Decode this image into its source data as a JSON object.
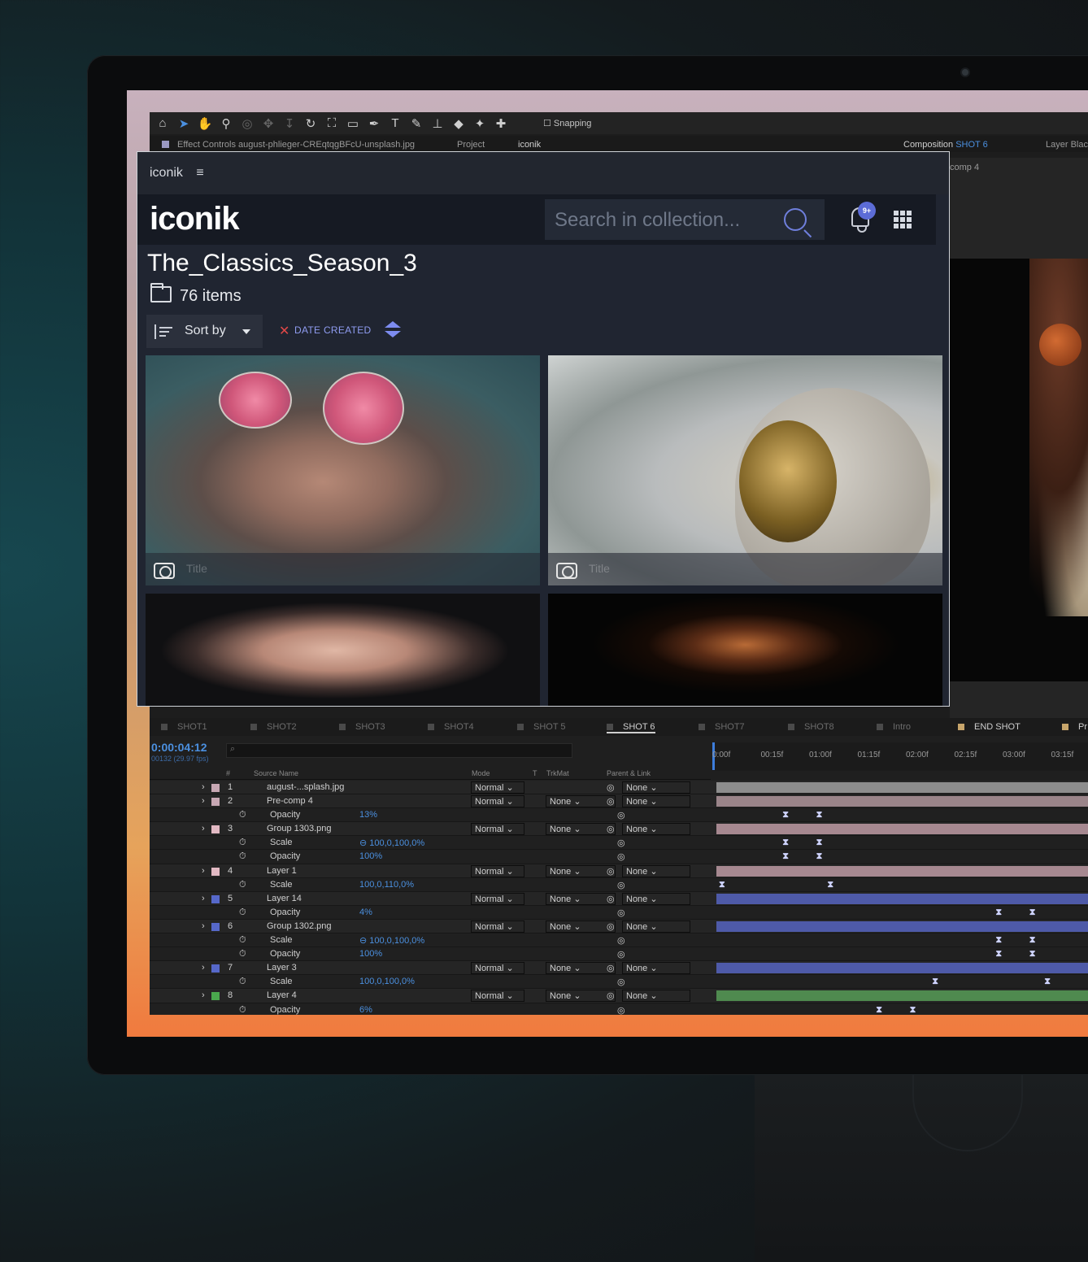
{
  "ae": {
    "snapping_label": "Snapping",
    "effect_controls_tab": "Effect Controls august-phlieger-CREqtqgBFcU-unsplash.jpg",
    "project_tab": "Project",
    "iconik_tab": "iconik",
    "composition_label": "Composition",
    "composition_name": "SHOT 6",
    "layer_tab": "Layer Black",
    "comp_breadcrumb": "comp 4",
    "timeline_tabs": [
      "SHOT1",
      "SHOT2",
      "SHOT3",
      "SHOT4",
      "SHOT 5",
      "SHOT 6",
      "SHOT7",
      "SHOT8",
      "Intro",
      "END SHOT",
      "Pr"
    ],
    "timecode": "0:00:04:12",
    "fps": "00132 (29.97 fps)",
    "search_glyph": "⌕",
    "columns": {
      "source_name": "Source Name",
      "mode": "Mode",
      "trkmat_t": "T",
      "trkmat": "TrkMat",
      "parent": "Parent & Link",
      "number": "#"
    },
    "ruler": [
      "0:00f",
      "00:15f",
      "01:00f",
      "01:15f",
      "02:00f",
      "02:15f",
      "03:00f",
      "03:15f"
    ],
    "rows": [
      {
        "kind": "layer",
        "num": "1",
        "name": "august-...splash.jpg",
        "mode": "Normal",
        "trkmat": "",
        "parent": "None",
        "label_color": "#c7a7b3",
        "bar_color": "#8d8d8d"
      },
      {
        "kind": "layer",
        "num": "2",
        "name": "Pre-comp 4",
        "mode": "Normal",
        "trkmat": "None",
        "parent": "None",
        "label_color": "#c7a7b3",
        "bar_color": "#9a8489"
      },
      {
        "kind": "prop",
        "name": "Opacity",
        "value": "13%",
        "keys": [
          0.17,
          0.26
        ]
      },
      {
        "kind": "layer",
        "num": "3",
        "name": "Group 1303.png",
        "mode": "Normal",
        "trkmat": "None",
        "parent": "None",
        "label_color": "#e2b9c3",
        "bar_color": "#a68890"
      },
      {
        "kind": "prop",
        "name": "Scale",
        "value": "100,0,100,0%",
        "link": true,
        "keys": [
          0.17,
          0.26
        ]
      },
      {
        "kind": "prop",
        "name": "Opacity",
        "value": "100%",
        "keys": [
          0.17,
          0.26
        ]
      },
      {
        "kind": "layer",
        "num": "4",
        "name": "Layer 1",
        "mode": "Normal",
        "trkmat": "None",
        "parent": "None",
        "label_color": "#e2b9c3",
        "bar_color": "#a68890"
      },
      {
        "kind": "prop",
        "name": "Scale",
        "value": "100,0,110,0%",
        "keys": [
          0.0,
          0.29
        ]
      },
      {
        "kind": "layer",
        "num": "5",
        "name": "Layer 14",
        "mode": "Normal",
        "trkmat": "None",
        "parent": "None",
        "label_color": "#5668c9",
        "bar_color": "#4e5aa8"
      },
      {
        "kind": "prop",
        "name": "Opacity",
        "value": "4%",
        "keys": [
          0.74,
          0.83
        ]
      },
      {
        "kind": "layer",
        "num": "6",
        "name": "Group 1302.png",
        "mode": "Normal",
        "trkmat": "None",
        "parent": "None",
        "label_color": "#5668c9",
        "bar_color": "#4e5aa8"
      },
      {
        "kind": "prop",
        "name": "Scale",
        "value": "100,0,100,0%",
        "link": true,
        "keys": [
          0.74,
          0.83
        ]
      },
      {
        "kind": "prop",
        "name": "Opacity",
        "value": "100%",
        "keys": [
          0.74,
          0.83
        ]
      },
      {
        "kind": "layer",
        "num": "7",
        "name": "Layer 3",
        "mode": "Normal",
        "trkmat": "None",
        "parent": "None",
        "label_color": "#5668c9",
        "bar_color": "#4e5aa8"
      },
      {
        "kind": "prop",
        "name": "Scale",
        "value": "100,0,100,0%",
        "keys": [
          0.57,
          0.87
        ]
      },
      {
        "kind": "layer",
        "num": "8",
        "name": "Layer 4",
        "mode": "Normal",
        "trkmat": "None",
        "parent": "None",
        "label_color": "#4aa84d",
        "bar_color": "#4f8a4f"
      },
      {
        "kind": "prop",
        "name": "Opacity",
        "value": "6%",
        "keys": [
          0.42,
          0.51
        ]
      }
    ]
  },
  "panel": {
    "window_title": "iconik",
    "menu_glyph": "≡",
    "logo": "iconik",
    "search_placeholder": "Search in collection...",
    "notification_badge": "9+",
    "collection_title": "The_Classics_Season_3",
    "item_count": "76 items",
    "sort_label": "Sort by",
    "sort_clear": "✕",
    "sort_field": "DATE CREATED",
    "tiles": [
      {
        "caption": "Title"
      },
      {
        "caption": "Title"
      },
      {
        "caption": ""
      },
      {
        "caption": ""
      }
    ]
  }
}
